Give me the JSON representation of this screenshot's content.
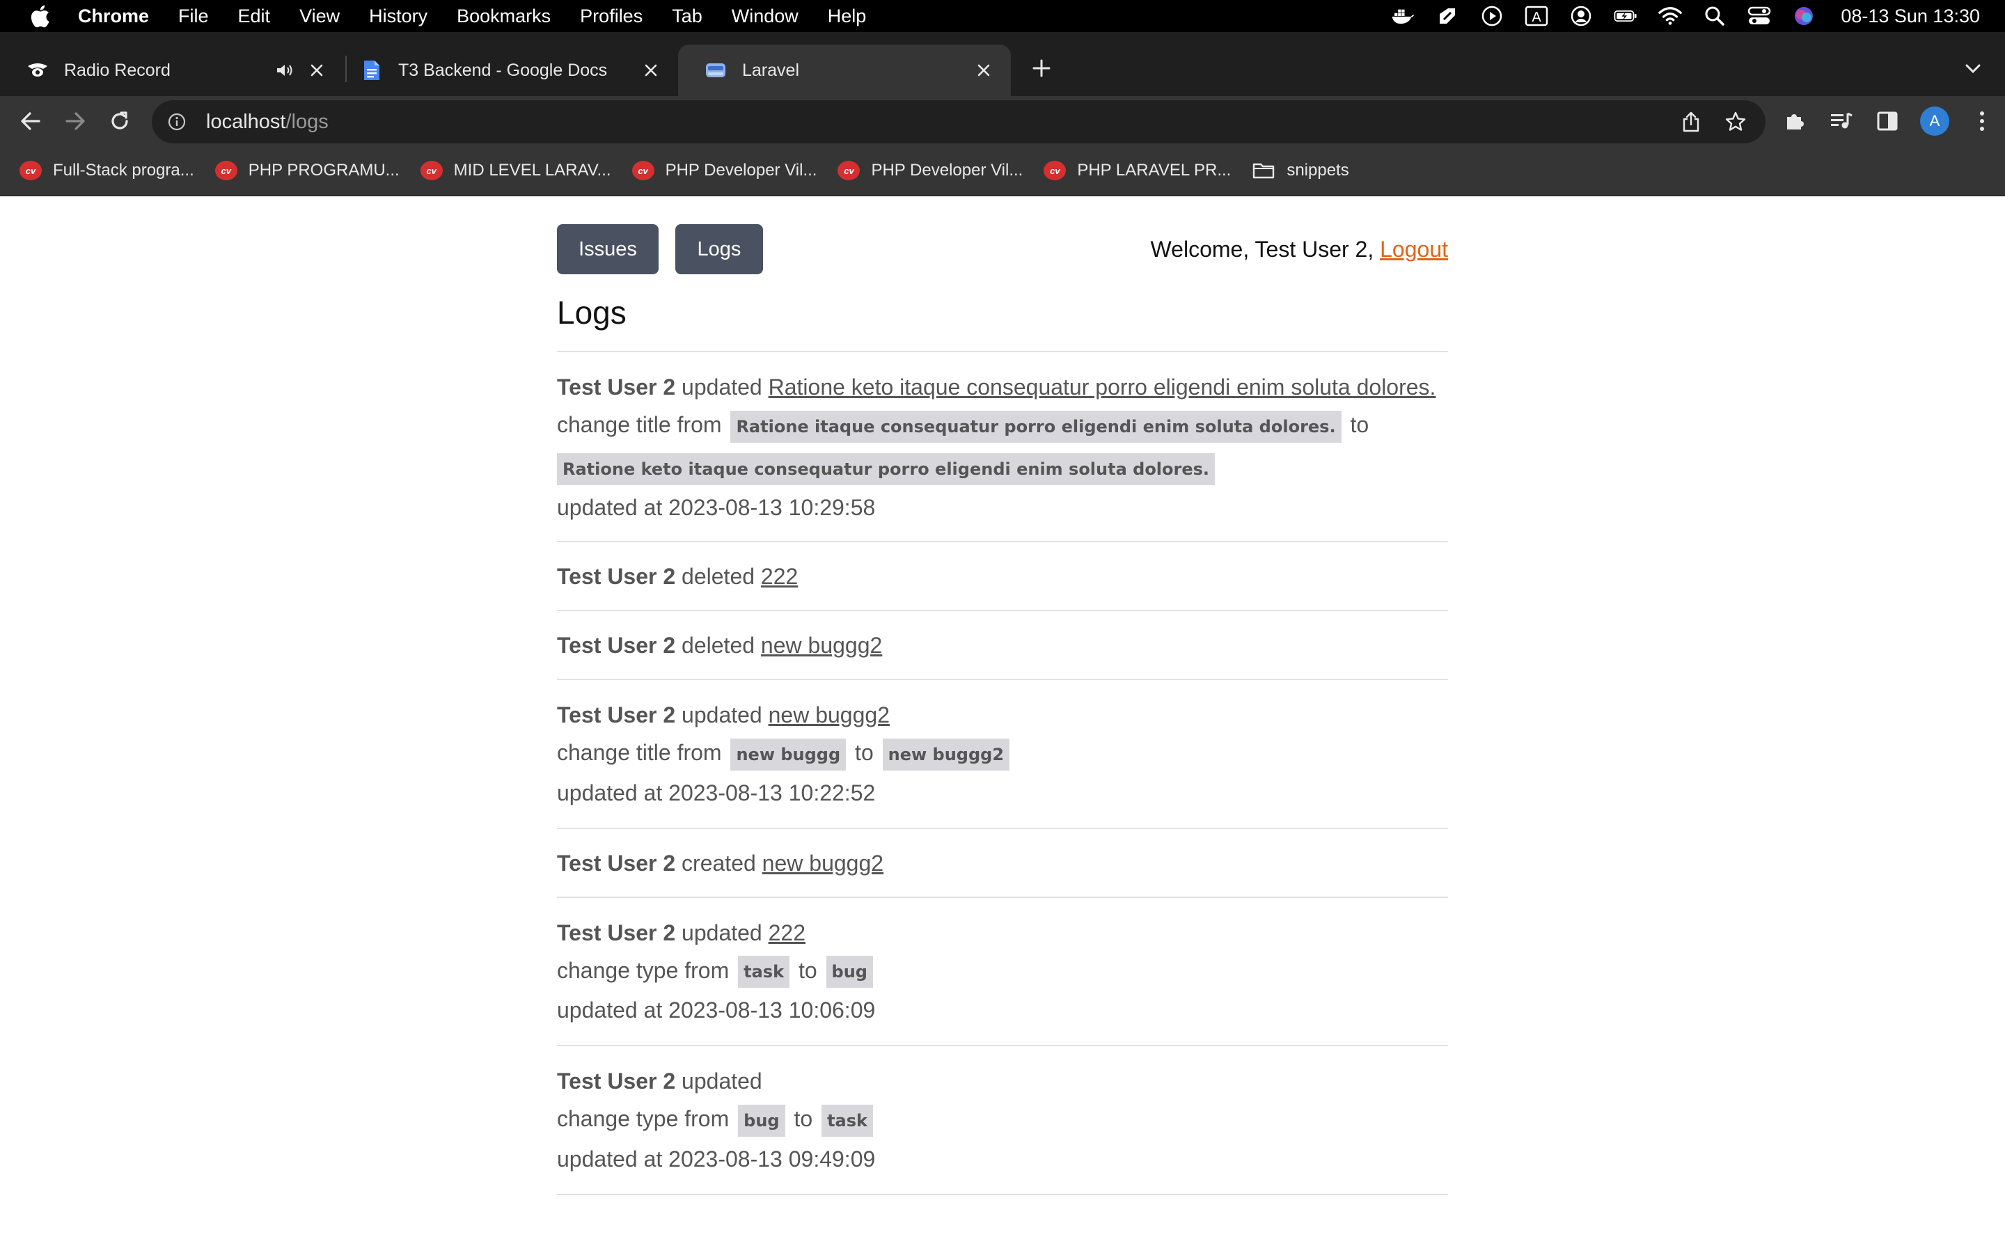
{
  "menubar": {
    "app_name": "Chrome",
    "items": [
      "File",
      "Edit",
      "View",
      "History",
      "Bookmarks",
      "Profiles",
      "Tab",
      "Window",
      "Help"
    ],
    "clock": "08-13 Sun  13:30"
  },
  "tabs": [
    {
      "title": "Radio Record",
      "active": false,
      "icon": "radio-record-icon",
      "audio": true
    },
    {
      "title": "T3 Backend - Google Docs",
      "active": false,
      "icon": "google-docs-icon"
    },
    {
      "title": "Laravel",
      "active": true,
      "icon": "laravel-page-icon"
    }
  ],
  "address": {
    "host": "localhost",
    "path": "/logs"
  },
  "profile_initial": "A",
  "bookmarks": [
    {
      "label": "Full-Stack progra...",
      "icon": "cv-icon"
    },
    {
      "label": "PHP PROGRAMU...",
      "icon": "cv-icon"
    },
    {
      "label": "MID LEVEL LARAV...",
      "icon": "cv-icon"
    },
    {
      "label": "PHP Developer Vil...",
      "icon": "cv-icon"
    },
    {
      "label": "PHP Developer Vil...",
      "icon": "cv-icon"
    },
    {
      "label": "PHP LARAVEL PR...",
      "icon": "cv-icon"
    },
    {
      "label": "snippets",
      "icon": "folder-icon"
    }
  ],
  "page": {
    "nav": {
      "issues": "Issues",
      "logs": "Logs"
    },
    "welcome_prefix": "Welcome, Test User 2, ",
    "logout": "Logout",
    "title": "Logs",
    "logs": [
      {
        "user": "Test User 2",
        "action": " updated ",
        "target": "Ratione keto itaque consequatur porro eligendi enim soluta dolores.",
        "change_prefix": "change title from ",
        "from": "Ratione itaque consequatur porro eligendi enim soluta dolores.",
        "to_word": " to ",
        "to": "Ratione keto itaque consequatur porro eligendi enim soluta dolores.",
        "updated_at": "updated at 2023-08-13 10:29:58"
      },
      {
        "user": "Test User 2",
        "action": " deleted ",
        "target": "222"
      },
      {
        "user": "Test User 2",
        "action": " deleted ",
        "target": "new buggg2"
      },
      {
        "user": "Test User 2",
        "action": " updated ",
        "target": "new buggg2",
        "change_prefix": "change title from ",
        "from": "new buggg",
        "to_word": " to ",
        "to": "new buggg2",
        "updated_at": "updated at 2023-08-13 10:22:52"
      },
      {
        "user": "Test User 2",
        "action": " created ",
        "target": "new buggg2"
      },
      {
        "user": "Test User 2",
        "action": " updated ",
        "target": "222",
        "change_prefix": "change type from ",
        "from": "task",
        "to_word": " to ",
        "to": "bug",
        "updated_at": "updated at 2023-08-13 10:06:09"
      },
      {
        "user": "Test User 2",
        "action": " updated",
        "change_prefix": "change type from ",
        "from": "bug",
        "to_word": " to ",
        "to": "task",
        "updated_at": "updated at 2023-08-13 09:49:09"
      }
    ]
  },
  "colors": {
    "menubar": "#000000",
    "tabstrip": "#1f1f1f",
    "toolbar": "#353535",
    "button_bg": "#4a5261",
    "logout_link": "#e36414",
    "chip_bg": "#d8d8dc"
  }
}
